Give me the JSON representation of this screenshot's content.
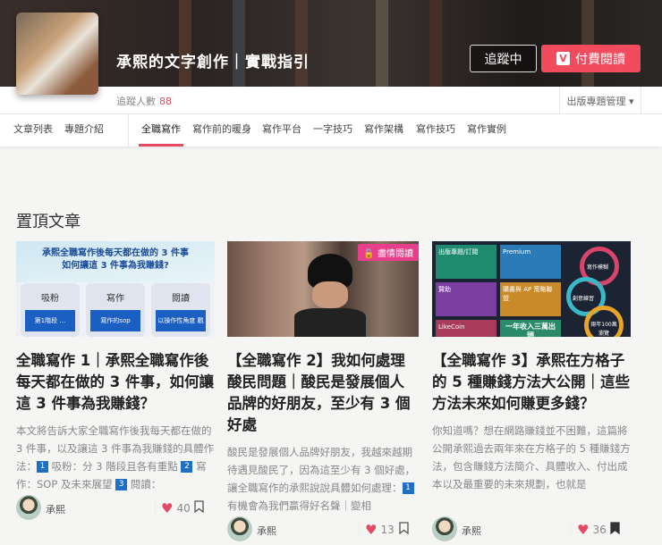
{
  "header": {
    "title": "承熙的文字創作｜實戰指引",
    "follow_button": "追蹤中",
    "paid_button": "付費閱讀",
    "paid_icon": "V",
    "followers_label": "追蹤人數",
    "followers_count": "88",
    "manage_menu": "出版專題管理 ▾"
  },
  "nav": {
    "left": [
      "文章列表",
      "專題介紹"
    ],
    "tabs": [
      "全職寫作",
      "寫作前的暖身",
      "寫作平台",
      "一字技巧",
      "寫作架構",
      "寫作技巧",
      "寫作實例"
    ],
    "active_tab": "全職寫作"
  },
  "section_title": "置頂文章",
  "cards": [
    {
      "thumb_text": {
        "headline1": "承熙全職寫作後每天都在做的 3 件事",
        "headline2": "如何讓這 3 件事為我賺錢?",
        "boxes": [
          "吸粉",
          "寫作",
          "閱讀"
        ],
        "box_inner": [
          "第1階段 …",
          "寫作的sop",
          "以操作性角度 觀書"
        ]
      },
      "title": "全職寫作 1｜承熙全職寫作後每天都在做的 3 件事，如何讓這 3 件事為我賺錢？",
      "excerpt_parts": [
        "本文將告訴大家全職寫作後我每天都在做的 3 件事，以及讓這 3 件事為我賺錢的具體作法：",
        "1",
        " 吸粉：分 3 階段且各有重點 ",
        "2",
        " 寫作：SOP 及未來展望 ",
        "3",
        " 閱讀："
      ],
      "author": "承熙",
      "likes": "40",
      "bookmarked": false
    },
    {
      "badge": "盡情閱讀",
      "title": "【全職寫作 2】我如何處理酸民問題｜酸民是發展個人品牌的好朋友，至少有 3 個好處",
      "excerpt_parts": [
        "酸民是發展個人品牌好朋友，我越來越期待遇見酸民了，因為這至少有 3 個好處，讓全職寫作的承熙說說具體如何處理：",
        "1",
        " 有機會為我們贏得好名聲｜變相"
      ],
      "author": "承熙",
      "likes": "13",
      "bookmarked": false
    },
    {
      "thumb_text": {
        "blocks": [
          "出版專題/訂閱",
          "Premium",
          "贊助",
          "購書與 AP 策略聯盟",
          "LikeCoin",
          "一年收入三萬出頭"
        ],
        "rings": [
          "寫作模糊",
          "創意練習",
          "兩年100萬瀏覽"
        ]
      },
      "title": "【全職寫作 3】承熙在方格子的 5 種賺錢方法大公開｜這些方法未來如何賺更多錢？",
      "excerpt_parts": [
        "你知道嗎？想在網路賺錢並不困難，這篇將公開承熙過去兩年來在方格子的 5 種賺錢方法，包含賺錢方法簡介、具體收入、付出成本以及最重要的未來規劃，也就是"
      ],
      "author": "承熙",
      "likes": "36",
      "bookmarked": true
    }
  ],
  "colors": {
    "accent": "#f24b5d",
    "badge": "#e83e8c",
    "number_box": "#1f6fc5"
  }
}
